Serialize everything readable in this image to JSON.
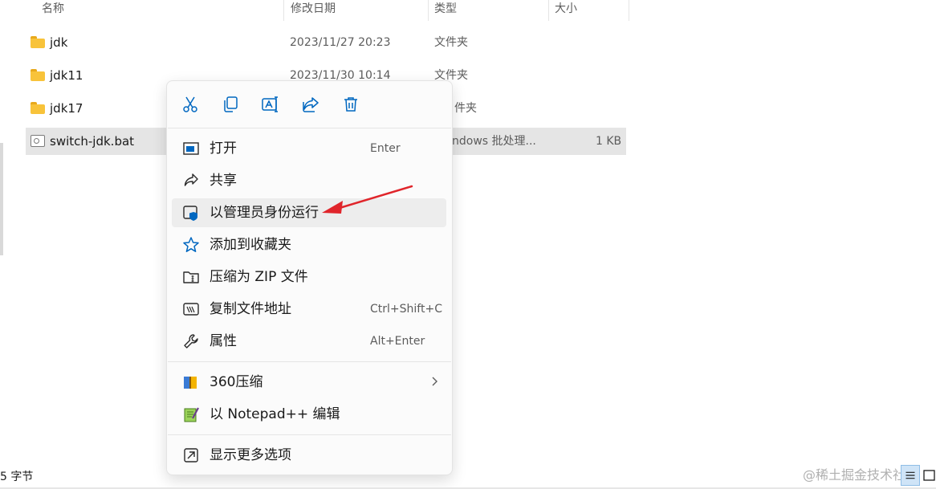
{
  "columns": {
    "name": "名称",
    "modified": "修改日期",
    "type": "类型",
    "size": "大小"
  },
  "files": [
    {
      "name": "jdk",
      "modified": "2023/11/27 20:23",
      "type": "文件夹",
      "size": "",
      "icon": "folder-icon"
    },
    {
      "name": "jdk11",
      "modified": "2023/11/30 10:14",
      "type": "文件夹",
      "size": "",
      "icon": "folder-icon"
    },
    {
      "name": "jdk17",
      "modified": "",
      "type": "件夹",
      "size": "",
      "icon": "folder-icon"
    },
    {
      "name": "switch-jdk.bat",
      "modified": "",
      "type": "ndows 批处理...",
      "size": "1 KB",
      "icon": "batch-file-icon"
    }
  ],
  "quick_actions": [
    "cut-icon",
    "copy-icon",
    "rename-icon",
    "share-icon",
    "delete-icon"
  ],
  "menu": {
    "items": [
      {
        "label": "打开",
        "accel": "Enter",
        "icon": "open-icon"
      },
      {
        "label": "共享",
        "accel": "",
        "icon": "share-icon"
      },
      {
        "label": "以管理员身份运行",
        "accel": "",
        "icon": "run-as-admin-icon"
      },
      {
        "label": "添加到收藏夹",
        "accel": "",
        "icon": "star-icon"
      },
      {
        "label": "压缩为 ZIP 文件",
        "accel": "",
        "icon": "zip-icon"
      },
      {
        "label": "复制文件地址",
        "accel": "Ctrl+Shift+C",
        "icon": "copy-path-icon"
      },
      {
        "label": "属性",
        "accel": "Alt+Enter",
        "icon": "wrench-icon"
      }
    ],
    "ext_items": [
      {
        "label": "360压缩",
        "icon": "360-zip-icon"
      },
      {
        "label": "以 Notepad++ 编辑",
        "icon": "notepadpp-icon"
      }
    ],
    "more": {
      "label": "显示更多选项",
      "icon": "more-options-icon"
    }
  },
  "status": {
    "text": "5 字节"
  },
  "watermark": "@稀土掘金技术社区",
  "colors": {
    "accent": "#0067c0",
    "arrow": "#e0252b",
    "folder": "#f8c33a",
    "selected": "#e5e5e5"
  }
}
